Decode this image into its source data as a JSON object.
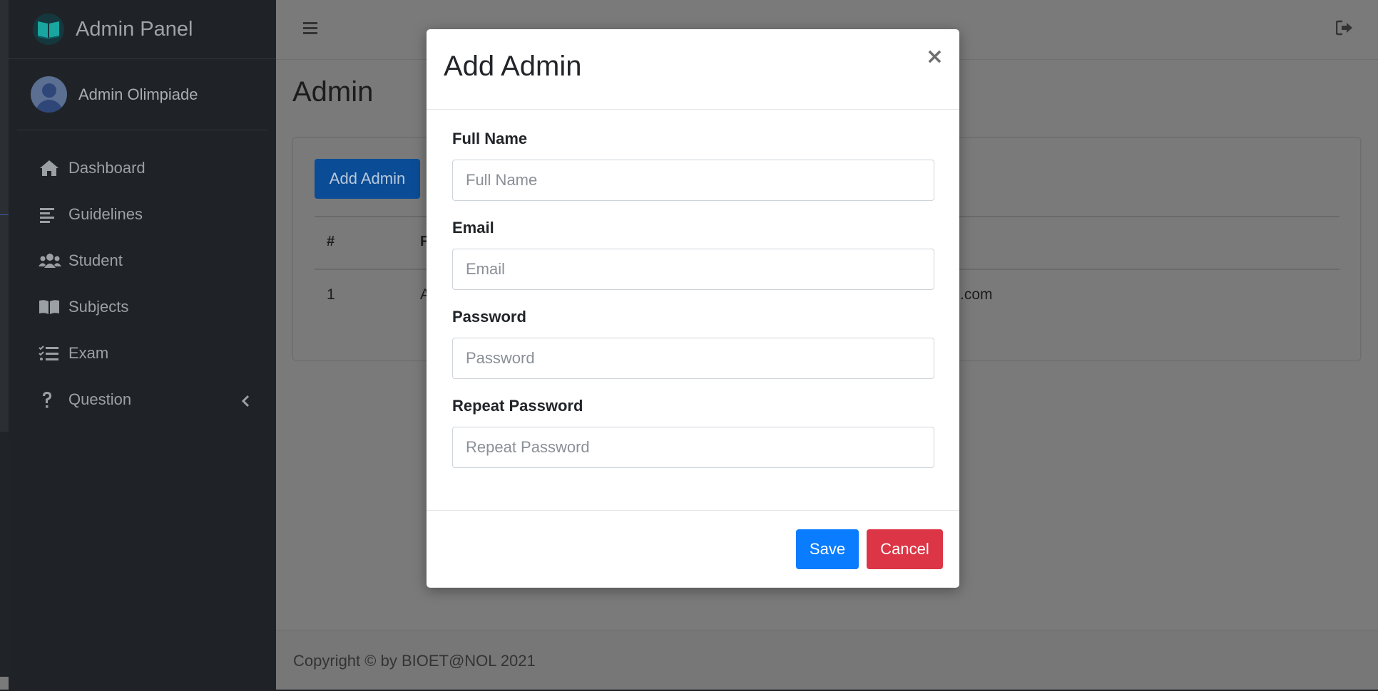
{
  "app": {
    "brand_title": "Admin Panel",
    "user_name": "Admin Olimpiade"
  },
  "sidebar": {
    "items": [
      {
        "label": "Dashboard",
        "icon": "home-icon"
      },
      {
        "label": "Guidelines",
        "icon": "align-left-icon"
      },
      {
        "label": "Student",
        "icon": "users-icon"
      },
      {
        "label": "Subjects",
        "icon": "book-icon"
      },
      {
        "label": "Exam",
        "icon": "tasks-icon"
      },
      {
        "label": "Question",
        "icon": "question-icon"
      }
    ]
  },
  "page": {
    "title": "Admin",
    "add_button": "Add Admin",
    "table": {
      "headers": [
        "#",
        "F"
      ],
      "rows": [
        {
          "num": "1",
          "name": "A",
          "email": ".com"
        }
      ]
    }
  },
  "footer": {
    "text": "Copyright © by BIOET@NOL 2021"
  },
  "modal": {
    "title": "Add Admin",
    "close": "×",
    "fields": [
      {
        "label": "Full Name",
        "placeholder": "Full Name"
      },
      {
        "label": "Email",
        "placeholder": "Email"
      },
      {
        "label": "Password",
        "placeholder": "Password"
      },
      {
        "label": "Repeat Password",
        "placeholder": "Repeat Password"
      }
    ],
    "save": "Save",
    "cancel": "Cancel"
  },
  "colors": {
    "primary": "#0a7cff",
    "danger": "#dc3545",
    "sidebar_bg": "#1f2327",
    "overlay_bg": "#7a7a7a"
  }
}
